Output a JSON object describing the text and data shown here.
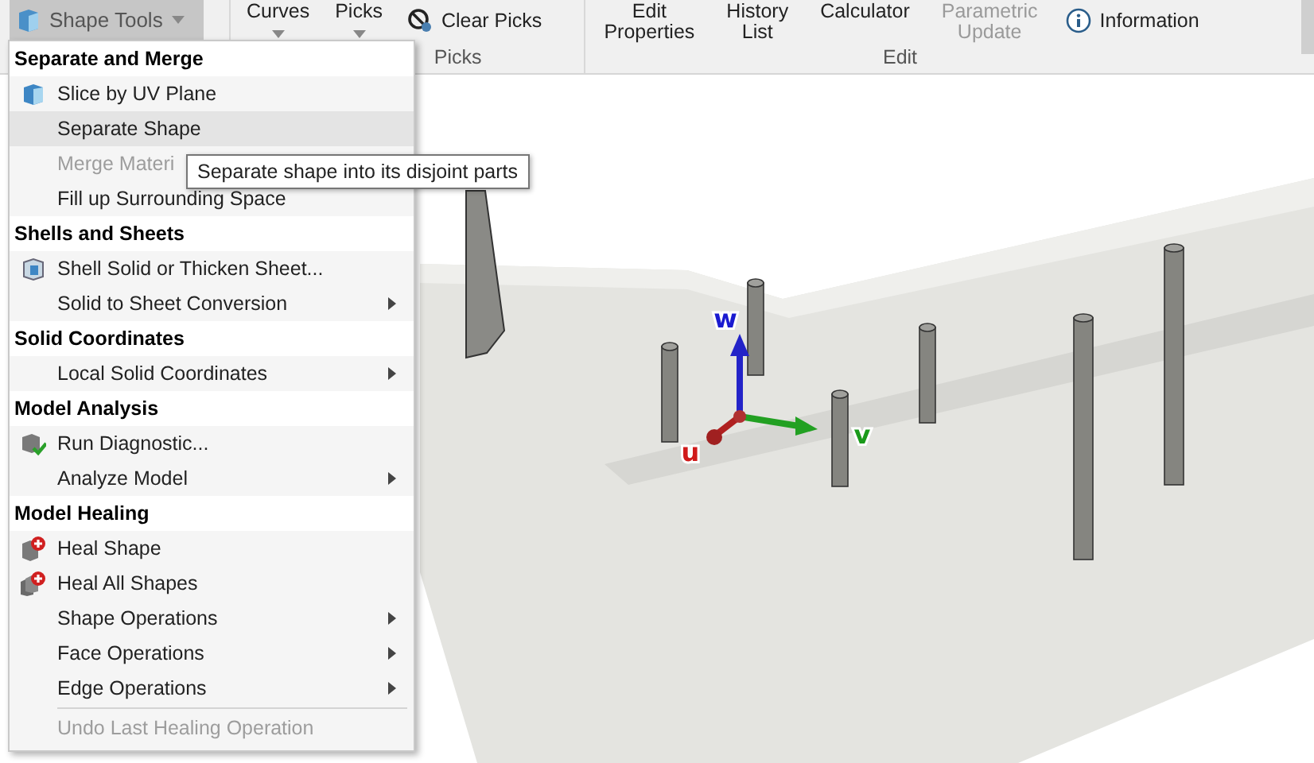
{
  "ribbon": {
    "shape_tools": {
      "label": "Shape Tools",
      "pressed": true
    },
    "groups": [
      {
        "label": "Picks",
        "items": [
          {
            "kind": "dropdown",
            "label": "Curves",
            "disabled": false
          },
          {
            "kind": "dropdown",
            "label": "Picks",
            "disabled": false
          },
          {
            "kind": "clear",
            "label": "Clear Picks",
            "disabled": false
          }
        ]
      },
      {
        "label": "Edit",
        "items": [
          {
            "kind": "stack",
            "lines": [
              "Edit",
              "Properties"
            ],
            "disabled": false
          },
          {
            "kind": "stack",
            "lines": [
              "History",
              "List"
            ],
            "disabled": false
          },
          {
            "kind": "stack",
            "lines": [
              "Calculator"
            ],
            "disabled": false
          },
          {
            "kind": "stack",
            "lines": [
              "Parametric",
              "Update"
            ],
            "disabled": true
          },
          {
            "kind": "info",
            "label": "Information",
            "disabled": false
          }
        ]
      }
    ]
  },
  "menu": [
    {
      "kind": "header",
      "label": "Separate and Merge"
    },
    {
      "kind": "item",
      "label": "Slice by UV Plane",
      "submenu": false,
      "disabled": false,
      "selected": false
    },
    {
      "kind": "item",
      "label": "Separate Shape",
      "submenu": false,
      "disabled": false,
      "selected": true
    },
    {
      "kind": "item",
      "label": "Merge Materi",
      "submenu": false,
      "disabled": true,
      "selected": false
    },
    {
      "kind": "item",
      "label": "Fill up Surrounding Space",
      "submenu": false,
      "disabled": false,
      "selected": false
    },
    {
      "kind": "header",
      "label": "Shells and Sheets"
    },
    {
      "kind": "item",
      "label": "Shell Solid or Thicken Sheet...",
      "submenu": false,
      "disabled": false,
      "selected": false
    },
    {
      "kind": "item",
      "label": "Solid to Sheet Conversion",
      "submenu": true,
      "disabled": false,
      "selected": false
    },
    {
      "kind": "header",
      "label": "Solid Coordinates"
    },
    {
      "kind": "item",
      "label": "Local Solid Coordinates",
      "submenu": true,
      "disabled": false,
      "selected": false
    },
    {
      "kind": "header",
      "label": "Model Analysis"
    },
    {
      "kind": "item",
      "label": "Run Diagnostic...",
      "submenu": false,
      "disabled": false,
      "selected": false
    },
    {
      "kind": "item",
      "label": "Analyze Model",
      "submenu": true,
      "disabled": false,
      "selected": false
    },
    {
      "kind": "header",
      "label": "Model Healing"
    },
    {
      "kind": "item",
      "label": "Heal Shape",
      "submenu": false,
      "disabled": false,
      "selected": false
    },
    {
      "kind": "item",
      "label": "Heal All Shapes",
      "submenu": false,
      "disabled": false,
      "selected": false
    },
    {
      "kind": "item",
      "label": "Shape Operations",
      "submenu": true,
      "disabled": false,
      "selected": false
    },
    {
      "kind": "item",
      "label": "Face Operations",
      "submenu": true,
      "disabled": false,
      "selected": false
    },
    {
      "kind": "item",
      "label": "Edge Operations",
      "submenu": true,
      "disabled": false,
      "selected": false
    },
    {
      "kind": "separator"
    },
    {
      "kind": "item",
      "label": "Undo Last Healing Operation",
      "submenu": false,
      "disabled": true,
      "selected": false
    }
  ],
  "tooltip": "Separate shape into its disjoint parts",
  "axes": [
    {
      "label": "w",
      "color": "#1a1ad0"
    },
    {
      "label": "v",
      "color": "#1a9a1a"
    },
    {
      "label": "u",
      "color": "#d01a1a"
    }
  ]
}
